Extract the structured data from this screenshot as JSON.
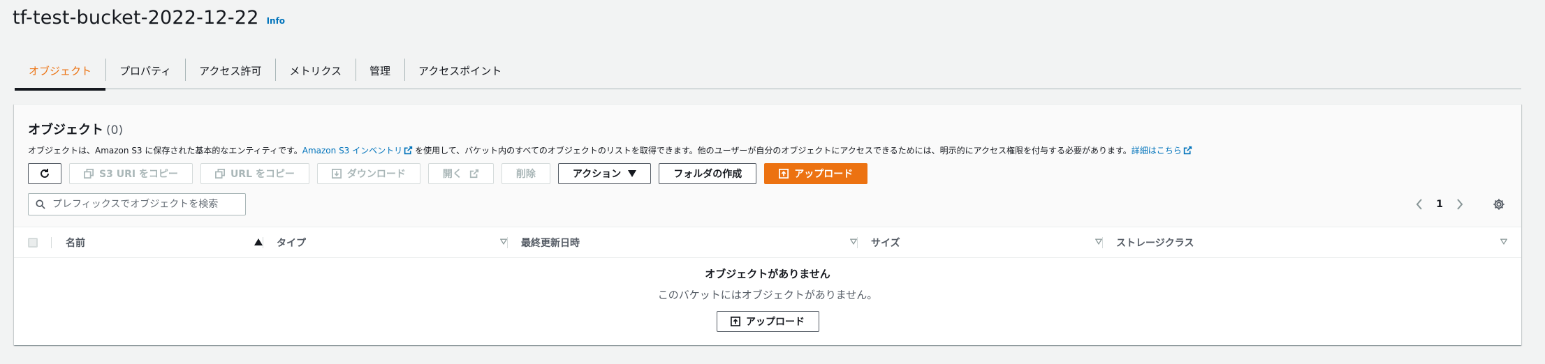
{
  "bucket": {
    "name": "tf-test-bucket-2022-12-22",
    "info_label": "Info"
  },
  "tabs": [
    {
      "label": "オブジェクト"
    },
    {
      "label": "プロパティ"
    },
    {
      "label": "アクセス許可"
    },
    {
      "label": "メトリクス"
    },
    {
      "label": "管理"
    },
    {
      "label": "アクセスポイント"
    }
  ],
  "active_tab": "オブジェクト",
  "objects_panel": {
    "title": "オブジェクト",
    "count": "(0)",
    "description_before": "オブジェクトは、Amazon S3 に保存された基本的なエンティティです。",
    "inventory_link": "Amazon S3 インベントリ",
    "description_after": "を使用して、バケット内のすべてのオブジェクトのリストを取得できます。他のユーザーが自分のオブジェクトにアクセスできるためには、明示的にアクセス権限を付与する必要があります。",
    "details_link": "詳細はこちら"
  },
  "toolbar": {
    "copy_s3_uri": "S3 URI をコピー",
    "copy_url": "URL をコピー",
    "download": "ダウンロード",
    "open": "開く",
    "delete": "削除",
    "actions": "アクション",
    "create_folder": "フォルダの作成",
    "upload": "アップロード"
  },
  "search": {
    "placeholder": "プレフィックスでオブジェクトを検索"
  },
  "pagination": {
    "current_page": "1"
  },
  "table": {
    "columns": [
      "名前",
      "タイプ",
      "最終更新日時",
      "サイズ",
      "ストレージクラス"
    ]
  },
  "empty_state": {
    "title": "オブジェクトがありません",
    "description": "このバケットにはオブジェクトがありません。",
    "upload_label": "アップロード"
  },
  "colors": {
    "accent": "#ec7211",
    "link": "#0073bb",
    "text": "#16191f",
    "secondary": "#545b64"
  }
}
